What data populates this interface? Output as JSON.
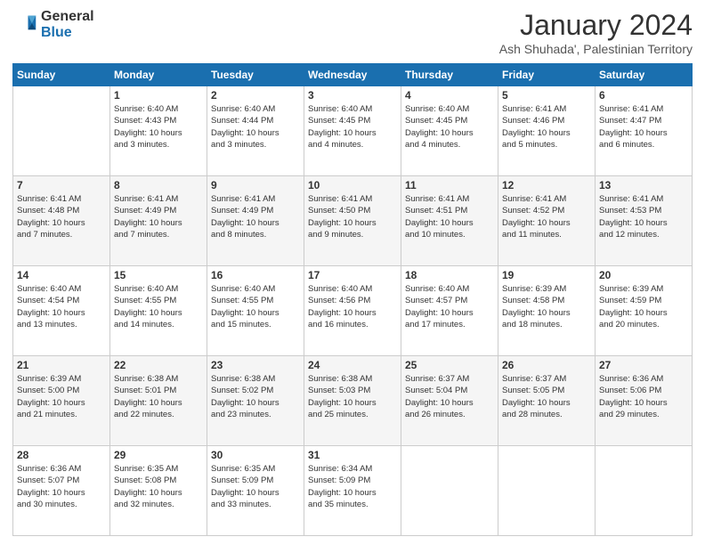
{
  "header": {
    "logo_general": "General",
    "logo_blue": "Blue",
    "month_title": "January 2024",
    "subtitle": "Ash Shuhada', Palestinian Territory"
  },
  "days_of_week": [
    "Sunday",
    "Monday",
    "Tuesday",
    "Wednesday",
    "Thursday",
    "Friday",
    "Saturday"
  ],
  "weeks": [
    [
      {
        "day": "",
        "info": ""
      },
      {
        "day": "1",
        "info": "Sunrise: 6:40 AM\nSunset: 4:43 PM\nDaylight: 10 hours\nand 3 minutes."
      },
      {
        "day": "2",
        "info": "Sunrise: 6:40 AM\nSunset: 4:44 PM\nDaylight: 10 hours\nand 3 minutes."
      },
      {
        "day": "3",
        "info": "Sunrise: 6:40 AM\nSunset: 4:45 PM\nDaylight: 10 hours\nand 4 minutes."
      },
      {
        "day": "4",
        "info": "Sunrise: 6:40 AM\nSunset: 4:45 PM\nDaylight: 10 hours\nand 4 minutes."
      },
      {
        "day": "5",
        "info": "Sunrise: 6:41 AM\nSunset: 4:46 PM\nDaylight: 10 hours\nand 5 minutes."
      },
      {
        "day": "6",
        "info": "Sunrise: 6:41 AM\nSunset: 4:47 PM\nDaylight: 10 hours\nand 6 minutes."
      }
    ],
    [
      {
        "day": "7",
        "info": "Sunrise: 6:41 AM\nSunset: 4:48 PM\nDaylight: 10 hours\nand 7 minutes."
      },
      {
        "day": "8",
        "info": "Sunrise: 6:41 AM\nSunset: 4:49 PM\nDaylight: 10 hours\nand 7 minutes."
      },
      {
        "day": "9",
        "info": "Sunrise: 6:41 AM\nSunset: 4:49 PM\nDaylight: 10 hours\nand 8 minutes."
      },
      {
        "day": "10",
        "info": "Sunrise: 6:41 AM\nSunset: 4:50 PM\nDaylight: 10 hours\nand 9 minutes."
      },
      {
        "day": "11",
        "info": "Sunrise: 6:41 AM\nSunset: 4:51 PM\nDaylight: 10 hours\nand 10 minutes."
      },
      {
        "day": "12",
        "info": "Sunrise: 6:41 AM\nSunset: 4:52 PM\nDaylight: 10 hours\nand 11 minutes."
      },
      {
        "day": "13",
        "info": "Sunrise: 6:41 AM\nSunset: 4:53 PM\nDaylight: 10 hours\nand 12 minutes."
      }
    ],
    [
      {
        "day": "14",
        "info": "Sunrise: 6:40 AM\nSunset: 4:54 PM\nDaylight: 10 hours\nand 13 minutes."
      },
      {
        "day": "15",
        "info": "Sunrise: 6:40 AM\nSunset: 4:55 PM\nDaylight: 10 hours\nand 14 minutes."
      },
      {
        "day": "16",
        "info": "Sunrise: 6:40 AM\nSunset: 4:55 PM\nDaylight: 10 hours\nand 15 minutes."
      },
      {
        "day": "17",
        "info": "Sunrise: 6:40 AM\nSunset: 4:56 PM\nDaylight: 10 hours\nand 16 minutes."
      },
      {
        "day": "18",
        "info": "Sunrise: 6:40 AM\nSunset: 4:57 PM\nDaylight: 10 hours\nand 17 minutes."
      },
      {
        "day": "19",
        "info": "Sunrise: 6:39 AM\nSunset: 4:58 PM\nDaylight: 10 hours\nand 18 minutes."
      },
      {
        "day": "20",
        "info": "Sunrise: 6:39 AM\nSunset: 4:59 PM\nDaylight: 10 hours\nand 20 minutes."
      }
    ],
    [
      {
        "day": "21",
        "info": "Sunrise: 6:39 AM\nSunset: 5:00 PM\nDaylight: 10 hours\nand 21 minutes."
      },
      {
        "day": "22",
        "info": "Sunrise: 6:38 AM\nSunset: 5:01 PM\nDaylight: 10 hours\nand 22 minutes."
      },
      {
        "day": "23",
        "info": "Sunrise: 6:38 AM\nSunset: 5:02 PM\nDaylight: 10 hours\nand 23 minutes."
      },
      {
        "day": "24",
        "info": "Sunrise: 6:38 AM\nSunset: 5:03 PM\nDaylight: 10 hours\nand 25 minutes."
      },
      {
        "day": "25",
        "info": "Sunrise: 6:37 AM\nSunset: 5:04 PM\nDaylight: 10 hours\nand 26 minutes."
      },
      {
        "day": "26",
        "info": "Sunrise: 6:37 AM\nSunset: 5:05 PM\nDaylight: 10 hours\nand 28 minutes."
      },
      {
        "day": "27",
        "info": "Sunrise: 6:36 AM\nSunset: 5:06 PM\nDaylight: 10 hours\nand 29 minutes."
      }
    ],
    [
      {
        "day": "28",
        "info": "Sunrise: 6:36 AM\nSunset: 5:07 PM\nDaylight: 10 hours\nand 30 minutes."
      },
      {
        "day": "29",
        "info": "Sunrise: 6:35 AM\nSunset: 5:08 PM\nDaylight: 10 hours\nand 32 minutes."
      },
      {
        "day": "30",
        "info": "Sunrise: 6:35 AM\nSunset: 5:09 PM\nDaylight: 10 hours\nand 33 minutes."
      },
      {
        "day": "31",
        "info": "Sunrise: 6:34 AM\nSunset: 5:09 PM\nDaylight: 10 hours\nand 35 minutes."
      },
      {
        "day": "",
        "info": ""
      },
      {
        "day": "",
        "info": ""
      },
      {
        "day": "",
        "info": ""
      }
    ]
  ]
}
